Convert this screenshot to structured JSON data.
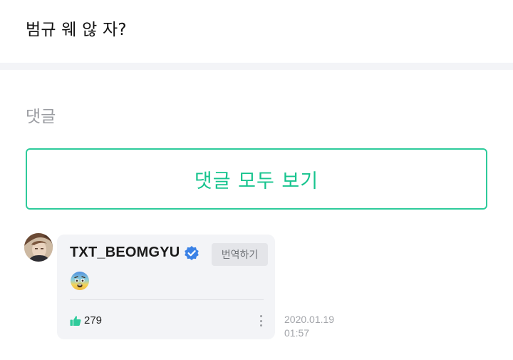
{
  "post": {
    "text": "범규 웨 않 자?"
  },
  "comments_section": {
    "heading": "댓글",
    "view_all_label": "댓글 모두 보기"
  },
  "comment": {
    "author": "TXT_BEOMGYU",
    "verified_icon": "verified-badge-icon",
    "translate_label": "번역하기",
    "content_emoji": "fearful-face-emoji",
    "like_icon": "thumbs-up-icon",
    "like_count": "279",
    "more_icon": "vertical-ellipsis-icon",
    "date": "2020.01.19",
    "time": "01:57"
  },
  "colors": {
    "accent_green": "#17c48e",
    "verified_blue": "#3b82e6",
    "card_background": "#f3f4f7",
    "muted_text": "#9a9ca1"
  }
}
